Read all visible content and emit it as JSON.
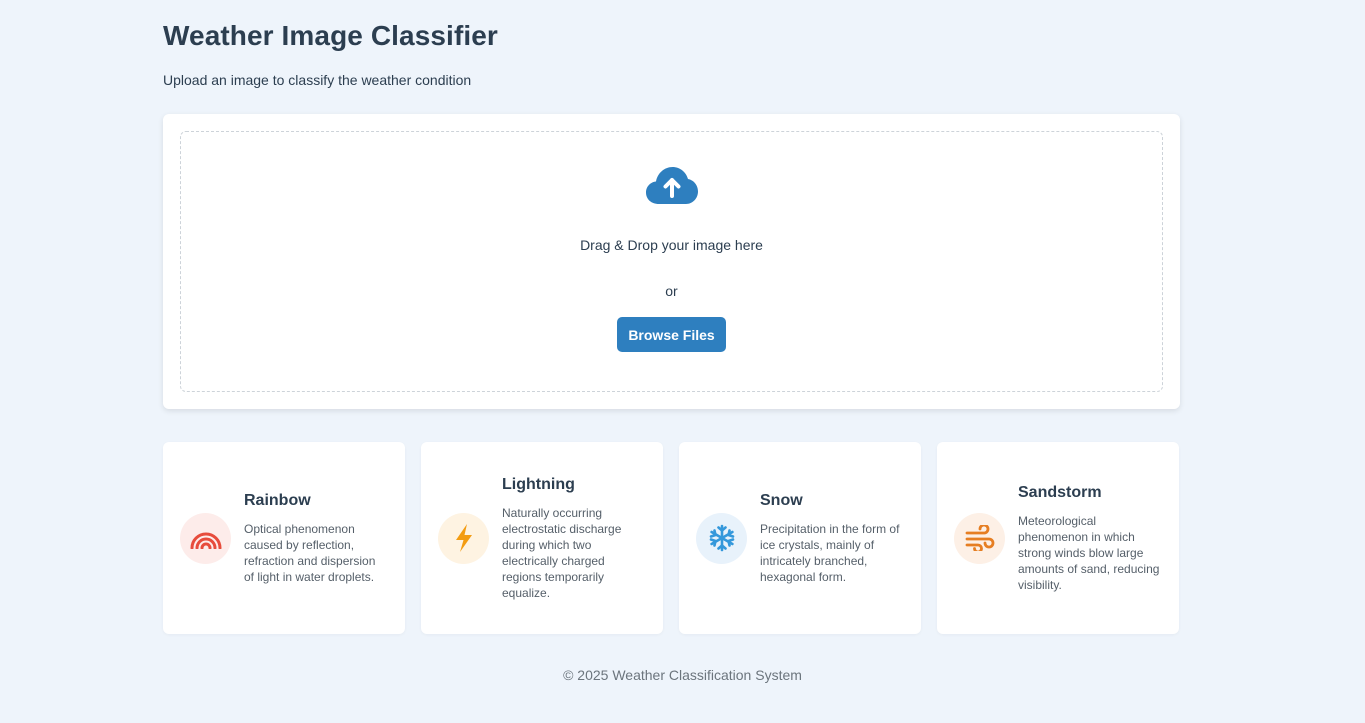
{
  "header": {
    "title": "Weather Image Classifier",
    "subtitle": "Upload an image to classify the weather condition"
  },
  "upload": {
    "icon": "cloud-upload-icon",
    "drop_text": "Drag & Drop your image here",
    "or_text": "or",
    "browse_label": "Browse Files"
  },
  "categories": [
    {
      "name": "Rainbow",
      "icon": "rainbow-icon",
      "color": "#e74c3c",
      "bg": "#fdecea",
      "description": "Optical phenomenon caused by reflection, refraction and dispersion of light in water droplets."
    },
    {
      "name": "Lightning",
      "icon": "lightning-icon",
      "color": "#f39c12",
      "bg": "#fef3e2",
      "description": "Naturally occurring electrostatic discharge during which two electrically charged regions temporarily equalize."
    },
    {
      "name": "Snow",
      "icon": "snowflake-icon",
      "color": "#3498db",
      "bg": "#e8f2fb",
      "description": "Precipitation in the form of ice crystals, mainly of intricately branched, hexagonal form."
    },
    {
      "name": "Sandstorm",
      "icon": "wind-icon",
      "color": "#e67e22",
      "bg": "#fdf0e6",
      "description": "Meteorological phenomenon in which strong winds blow large amounts of sand, reducing visibility."
    }
  ],
  "footer": {
    "text": "© 2025 Weather Classification System"
  },
  "colors": {
    "accent": "#2e7fbf",
    "background": "#eef4fb",
    "text": "#2c3e50"
  }
}
